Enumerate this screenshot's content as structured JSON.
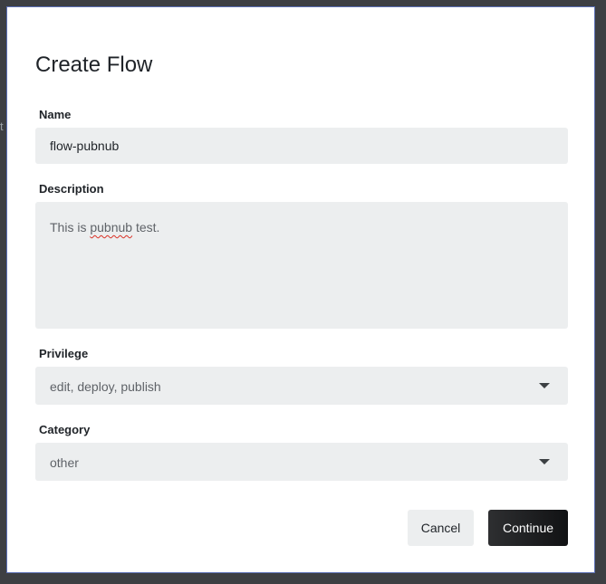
{
  "dialog": {
    "title": "Create Flow"
  },
  "fields": {
    "name": {
      "label": "Name",
      "value": "flow-pubnub"
    },
    "description": {
      "label": "Description",
      "value_before": "This is ",
      "value_misspelled": "pubnub",
      "value_after": " test."
    },
    "privilege": {
      "label": "Privilege",
      "value": "edit, deploy, publish",
      "icon": "chevron-down-icon"
    },
    "category": {
      "label": "Category",
      "value": "other",
      "icon": "chevron-down-icon"
    }
  },
  "actions": {
    "cancel_label": "Cancel",
    "continue_label": "Continue"
  },
  "backdrop": {
    "glyph": "t"
  },
  "colors": {
    "input_background": "#eceeef",
    "primary_button": "#1a1b1d",
    "modal_border": "#5b6fb5"
  }
}
